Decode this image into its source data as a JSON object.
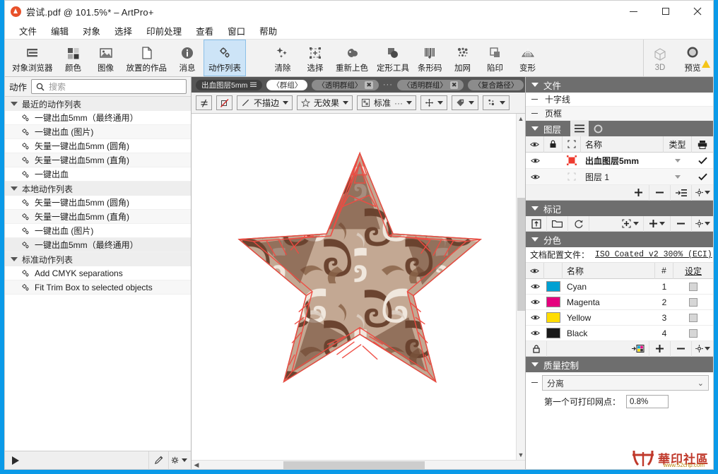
{
  "window": {
    "title": "尝试.pdf @ 101.5%* – ArtPro+",
    "minimize_label": "最小化",
    "maximize_label": "最大化",
    "close_label": "✕"
  },
  "menubar": {
    "items": [
      "文件",
      "编辑",
      "对象",
      "选择",
      "印前处理",
      "查看",
      "窗口",
      "帮助"
    ]
  },
  "ribbon": {
    "left_buttons": [
      {
        "label": "对象浏览器",
        "icon": "object-browser-icon",
        "active": false
      },
      {
        "label": "颜色",
        "icon": "color-icon",
        "active": false
      },
      {
        "label": "图像",
        "icon": "image-icon",
        "active": false
      },
      {
        "label": "放置的作品",
        "icon": "placed-art-icon",
        "active": false
      },
      {
        "label": "消息",
        "icon": "message-icon",
        "active": false
      },
      {
        "label": "动作列表",
        "icon": "action-list-icon",
        "active": true
      }
    ],
    "middle_buttons": [
      {
        "label": "清除",
        "icon": "clean-icon"
      },
      {
        "label": "选择",
        "icon": "select-icon"
      },
      {
        "label": "重新上色",
        "icon": "recolor-icon"
      },
      {
        "label": "定形工具",
        "icon": "shape-tool-icon"
      },
      {
        "label": "条形码",
        "icon": "barcode-icon"
      },
      {
        "label": "加网",
        "icon": "screening-icon"
      },
      {
        "label": "陷印",
        "icon": "trapping-icon"
      },
      {
        "label": "变形",
        "icon": "warp-icon"
      }
    ],
    "right_buttons": [
      {
        "label": "3D",
        "icon": "cube-3d-icon",
        "dim": true
      },
      {
        "label": "预览",
        "icon": "preview-icon",
        "dim": false,
        "warning": true
      }
    ]
  },
  "left_panel": {
    "header_label": "动作",
    "search_placeholder": "搜索",
    "search_value": "",
    "groups": [
      {
        "label": "最近的动作列表",
        "expanded": true,
        "items": [
          {
            "label": "一键出血5mm（最终通用）",
            "selected": false
          },
          {
            "label": "一键出血 (图片)",
            "selected": false
          },
          {
            "label": "矢量一键出血5mm (圆角)",
            "selected": false
          },
          {
            "label": "矢量一键出血5mm (直角)",
            "selected": false
          },
          {
            "label": "一键出血",
            "selected": false
          }
        ]
      },
      {
        "label": "本地动作列表",
        "expanded": true,
        "items": [
          {
            "label": "矢量一键出血5mm (圆角)",
            "selected": false
          },
          {
            "label": "矢量一键出血5mm (直角)",
            "selected": false
          },
          {
            "label": "一键出血 (图片)",
            "selected": false
          },
          {
            "label": "一键出血5mm（最终通用）",
            "selected": true
          }
        ]
      },
      {
        "label": "标准动作列表",
        "expanded": true,
        "items": [
          {
            "label": "Add CMYK separations",
            "selected": false
          },
          {
            "label": "Fit Trim Box to selected objects",
            "selected": false
          }
        ]
      }
    ],
    "footer": {
      "run_label": "▶",
      "edit_icon": "pencil-icon",
      "settings_icon": "gear-icon"
    }
  },
  "center": {
    "breadcrumb": [
      {
        "label": "出血图层5mm",
        "style": "dark",
        "menu": true
      },
      {
        "label": "〈群组〉",
        "style": "white"
      },
      {
        "label": "〈透明群组〉",
        "style": "grey",
        "close": true
      },
      {
        "label": "···",
        "style": "dots"
      },
      {
        "label": "〈透明群组〉",
        "style": "grey",
        "close": true
      },
      {
        "label": "〈复合路径〉",
        "style": "grey"
      }
    ],
    "toolbar": [
      {
        "name": "not-equal-button",
        "label": "≠",
        "type": "square"
      },
      {
        "name": "no-fill-button",
        "label": "",
        "type": "square-nofill"
      },
      {
        "name": "stroke-dropdown",
        "label": "不描边",
        "type": "dropdown",
        "icon": "stroke-icon"
      },
      {
        "name": "effect-dropdown",
        "label": "无效果",
        "type": "dropdown",
        "icon": "star-icon"
      },
      {
        "name": "blend-dropdown",
        "label": "标准",
        "type": "dropdown",
        "icon": "blend-icon",
        "extra": "···"
      },
      {
        "name": "move-dropdown",
        "label": "",
        "type": "dropdown",
        "icon": "move-icon"
      },
      {
        "name": "tag-dropdown",
        "label": "",
        "type": "dropdown",
        "icon": "tag-icon"
      },
      {
        "name": "screen-dropdown",
        "label": "",
        "type": "dropdown",
        "icon": "dots-icon"
      }
    ],
    "artwork": {
      "name": "star-artwork",
      "bleed_color": "#e8453c",
      "pattern_colors": [
        "#6b4632",
        "#8a6449",
        "#b99a83",
        "#ddd0c3",
        "#f5f1ec"
      ]
    }
  },
  "right_panel": {
    "file_section": {
      "title": "文件",
      "rows": [
        {
          "label": "十字线"
        },
        {
          "label": "页框"
        }
      ]
    },
    "layers_section": {
      "title": "图层",
      "tabs": [
        "list-view-icon",
        "circle-view-icon"
      ],
      "columns": [
        "眼睛",
        "锁",
        "选择",
        "名称",
        "类型",
        "打印"
      ],
      "column_name_label": "名称",
      "column_type_label": "类型",
      "rows": [
        {
          "name": "出血图层5mm",
          "visible": true,
          "bold": true,
          "thumb_color": "#ee3b2f",
          "print": true
        },
        {
          "name": "图层 1",
          "visible": true,
          "bold": false,
          "thumb_color": "#bdbdbd",
          "print": true
        }
      ],
      "toolbar": [
        "add-layer-button",
        "remove-layer-button",
        "move-layer-button",
        "layer-options-button"
      ]
    },
    "marks_section": {
      "title": "标记",
      "toolbar": [
        "import-marks-icon",
        "folder-icon",
        "refresh-icon",
        "add-mark-set-icon",
        "add-icon",
        "remove-icon",
        "gear-icon"
      ]
    },
    "separations_section": {
      "title": "分色",
      "profile_label": "文档配置文件：",
      "profile_value": "ISO Coated v2 300% (ECI)",
      "columns": {
        "visible": "",
        "name": "名称",
        "number": "#",
        "settings": "设定"
      },
      "rows": [
        {
          "name": "Cyan",
          "number": "1",
          "color": "#00a0d2",
          "visible": true
        },
        {
          "name": "Magenta",
          "number": "2",
          "color": "#e5007e",
          "visible": true
        },
        {
          "name": "Yellow",
          "number": "3",
          "color": "#ffdd00",
          "visible": true
        },
        {
          "name": "Black",
          "number": "4",
          "color": "#1a1a1a",
          "visible": true
        }
      ],
      "toolbar": [
        "lock-icon",
        "map-ink-icon",
        "add-icon",
        "remove-icon",
        "gear-icon"
      ]
    },
    "quality_section": {
      "title": "质量控制",
      "select_value": "分离",
      "field_label": "第一个可打印网点：",
      "field_value": "0.8%"
    },
    "watermark": {
      "text": "華印社區",
      "url": "www.52cnp.com"
    }
  }
}
